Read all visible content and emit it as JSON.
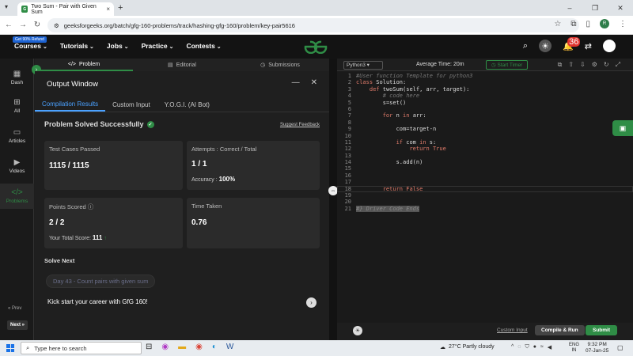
{
  "browser": {
    "tab_title": "Two Sum - Pair with Given Sum",
    "url": "geeksforgeeks.org/batch/gfg-160-problems/track/hashing-gfg-160/problem/key-pair5616"
  },
  "header": {
    "badge": "Get 90% Refund",
    "nav": [
      "Courses",
      "Tutorials",
      "Jobs",
      "Practice",
      "Contests"
    ],
    "logo": "GG",
    "notif_count": "36",
    "avatar": "R"
  },
  "sidebar": {
    "items": [
      {
        "label": "Dash",
        "icon": "dashboard-icon"
      },
      {
        "label": "All",
        "icon": "grid-icon"
      },
      {
        "label": "Articles",
        "icon": "book-icon"
      },
      {
        "label": "Videos",
        "icon": "video-icon"
      },
      {
        "label": "Problems",
        "icon": "code-icon"
      }
    ],
    "prev": "« Prev",
    "next": "Next »"
  },
  "problem_tabs": {
    "problem": "Problem",
    "editorial": "Editorial",
    "submissions": "Submissions"
  },
  "output": {
    "title": "Output Window",
    "tabs": [
      "Compilation Results",
      "Custom Input",
      "Y.O.G.I. (AI Bot)"
    ],
    "status": "Problem Solved Successfully",
    "feedback": "Suggest Feedback",
    "test_cases_label": "Test Cases Passed",
    "test_cases_value": "1115 / 1115",
    "attempts_label": "Attempts : Correct / Total",
    "attempts_value": "1 / 1",
    "accuracy_label": "Accuracy :",
    "accuracy_value": "100%",
    "points_label": "Points Scored",
    "points_value": "2 / 2",
    "total_score_label": "Your Total Score:",
    "total_score_value": "111",
    "time_label": "Time Taken",
    "time_value": "0.76",
    "solve_next": "Solve Next",
    "next_problem": "Day 43 - Count pairs with given sum",
    "kickstart": "Kick start your career with GfG 160!"
  },
  "editor": {
    "language": "Python3",
    "avg_time": "Average Time: 20m",
    "timer": "Start Timer",
    "lines": [
      "#User function Template for python3",
      "class Solution:",
      "    def twoSum(self, arr, target):",
      "        # code here",
      "        s=set()",
      "",
      "        for n in arr:",
      "",
      "            com=target-n",
      "",
      "            if com in s:",
      "                return True",
      "",
      "            s.add(n)",
      "",
      "",
      "",
      "        return False",
      "",
      "",
      "#} Driver Code Ends"
    ],
    "custom_input": "Custom Input",
    "compile": "Compile & Run",
    "submit": "Submit"
  },
  "taskbar": {
    "search_placeholder": "Type here to search",
    "weather": "27°C  Partly cloudy",
    "lang1": "ENG",
    "lang2": "IN",
    "time": "9:32 PM",
    "date": "07-Jan-25"
  }
}
